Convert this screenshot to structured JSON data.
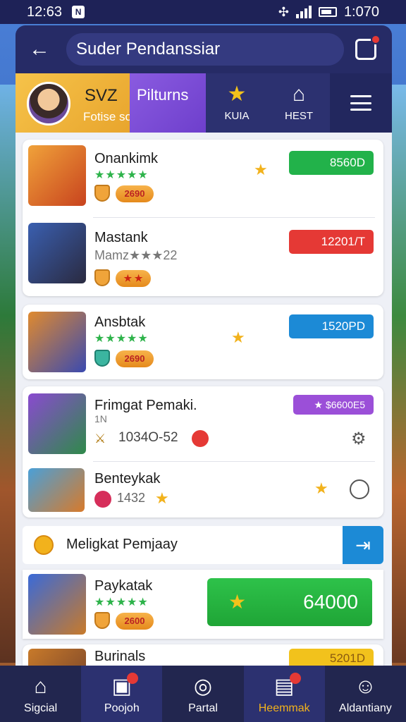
{
  "status": {
    "time": "12:63",
    "clock": "1:070"
  },
  "header": {
    "title": "Suder Pendanssiar"
  },
  "tabs": {
    "profile_name": "SVZ",
    "profile_sub": "Fotise sopeenlan",
    "stats_label": "Pilturns",
    "tab2_label": "KUIA",
    "tab3_label": "HEST"
  },
  "items": [
    {
      "name": "Onankimk",
      "sub": "",
      "badge": "2690",
      "price": "8560D",
      "price_color": "#22b24a",
      "stars": "★★★★★"
    },
    {
      "name": "Mastank",
      "sub": "Mamz★★★22",
      "badge": "★ ★",
      "price": "12201/T",
      "price_color": "#e53935",
      "stars": ""
    },
    {
      "name": "Ansbtak",
      "sub": "",
      "badge": "2690",
      "price": "1520PD",
      "price_color": "#1c8ad6",
      "stars": "★★★★★"
    },
    {
      "name": "Frimgat Pemaki.",
      "sub": "1N",
      "value": "1034O-52",
      "price": "★ $6600E5",
      "price_color": "#9b4fd8",
      "stars": ""
    },
    {
      "name": "Benteykak",
      "sub": "",
      "value": "1432",
      "price": "",
      "price_color": "",
      "stars": ""
    }
  ],
  "banner": {
    "text": "Meligkat Pemjaay"
  },
  "featured": {
    "name": "Paykatak",
    "badge": "2600",
    "button_value": "64000",
    "stars": "★★★★★"
  },
  "last_item": {
    "name": "Burinals",
    "price": "5201D",
    "price_color": "#f2c21c"
  },
  "nav": [
    {
      "label": "Sigcial",
      "icon": "home-icon"
    },
    {
      "label": "Poojoh",
      "icon": "gift-icon"
    },
    {
      "label": "Partal",
      "icon": "compass-icon"
    },
    {
      "label": "Heemmak",
      "icon": "shop-icon"
    },
    {
      "label": "Aldantiany",
      "icon": "user-icon"
    }
  ]
}
